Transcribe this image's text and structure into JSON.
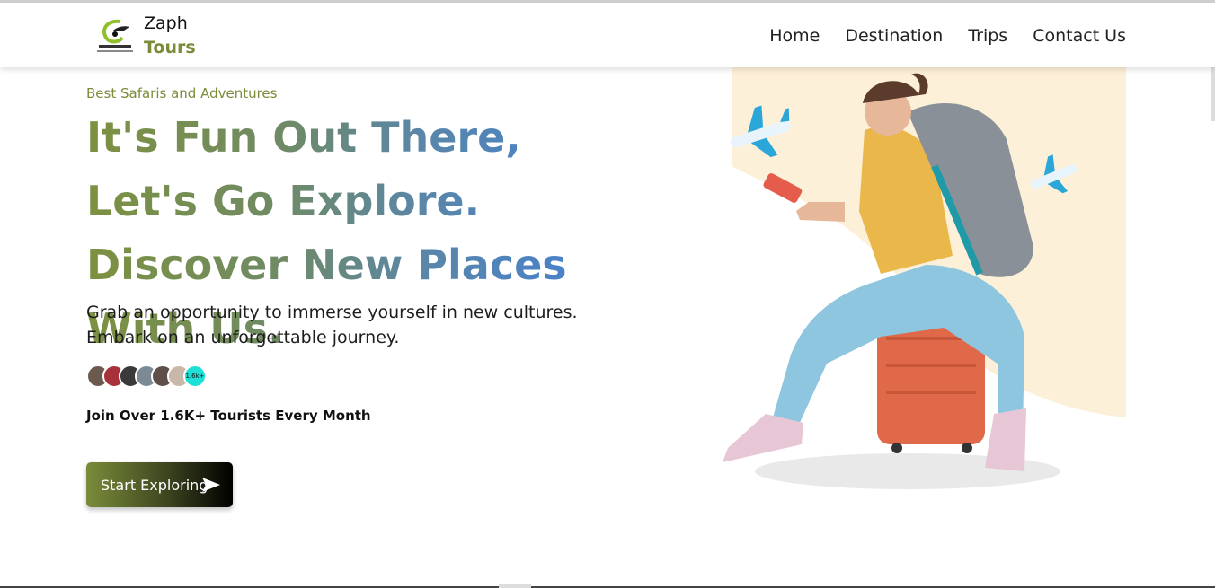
{
  "brand": {
    "name": "Zaph",
    "sub": "Tours",
    "logo_icon": "safari-logo-icon"
  },
  "nav": {
    "items": [
      {
        "label": "Home"
      },
      {
        "label": "Destination"
      },
      {
        "label": "Trips"
      },
      {
        "label": "Contact Us"
      }
    ]
  },
  "hero": {
    "tagline": "Best Safaris and Adventures",
    "headline": "It's Fun Out There, Let's Go Explore. Discover New Places With Us.",
    "description": "Grab an opportunity to immerse yourself in new cultures. Embark on an unforgettable journey.",
    "avatar_count_label": "1.6k+",
    "join_text": "Join Over 1.6K+ Tourists Every Month",
    "cta_label": "Start Exploring",
    "cta_icon": "send-arrow-icon"
  },
  "colors": {
    "accent_olive": "#7a8c3a",
    "accent_blue": "#3f7fd8",
    "avatar_badge": "#1de0d6",
    "hero_bg": "#fdf0d8"
  }
}
